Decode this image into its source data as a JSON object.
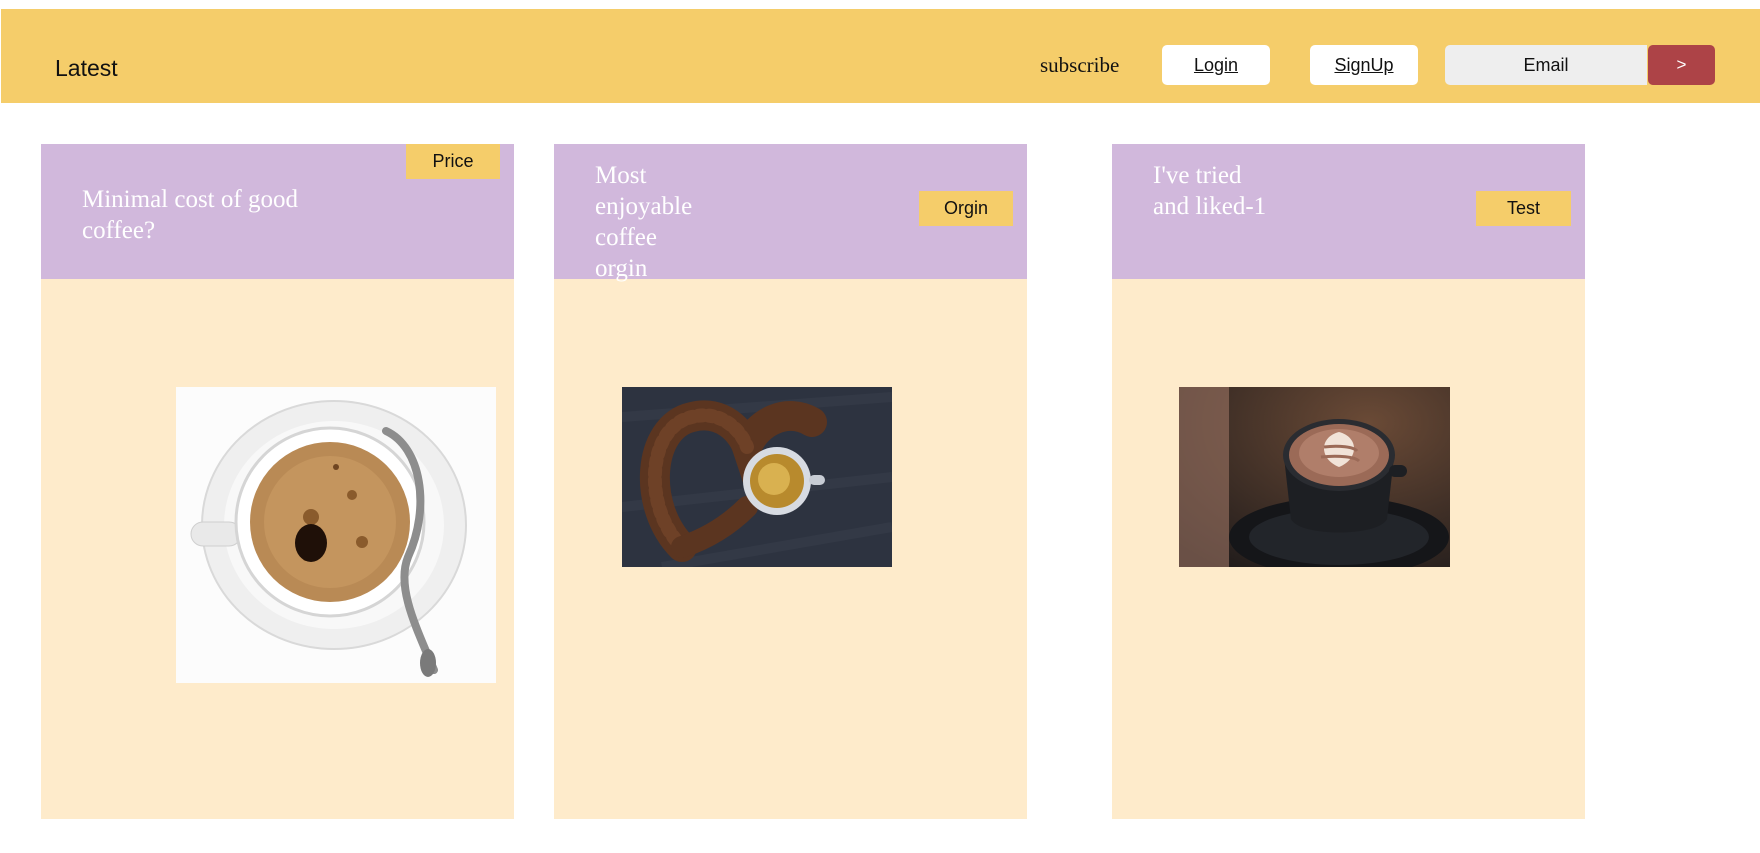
{
  "header": {
    "brand": "Latest",
    "subscribe_label": "subscribe",
    "login_label": "Login",
    "signup_label": "SignUp",
    "email_placeholder": "Email",
    "submit_label": ">"
  },
  "cards": [
    {
      "title": "Minimal cost of good coffee?",
      "tag": "Price",
      "image_icon": "coffee-cup-top-view-image"
    },
    {
      "title": "Most enjoyable coffee orgin",
      "tag": "Orgin",
      "image_icon": "coffee-bean-heart-image"
    },
    {
      "title": "I've tried and liked-1",
      "tag": "Test",
      "image_icon": "latte-art-image"
    }
  ],
  "colors": {
    "header_bg": "#f5cd6a",
    "card_head_bg": "#d1b8dc",
    "card_body_bg": "#feebcb",
    "submit_bg": "#ad4347",
    "tag_bg": "#f5cd6a"
  }
}
